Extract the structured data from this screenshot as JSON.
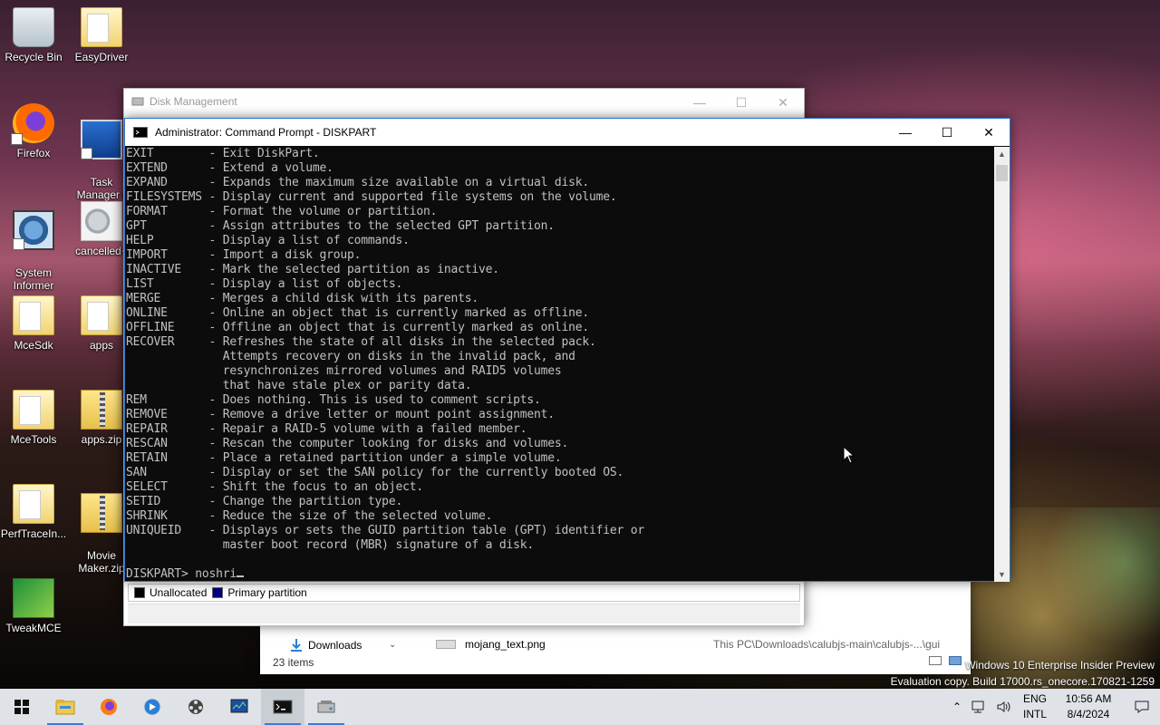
{
  "desktop": {
    "icons": [
      {
        "label": "Recycle Bin",
        "icon": "recycle-bin-icon"
      },
      {
        "label": "EasyDriver",
        "icon": "folder-icon"
      },
      {
        "label": "Firefox",
        "icon": "firefox-icon"
      },
      {
        "label": "Task\nManager (",
        "icon": "task-manager-icon"
      },
      {
        "label": "System\nInformer",
        "icon": "system-informer-icon"
      },
      {
        "label": "cancelled+",
        "icon": "gear-file-icon"
      },
      {
        "label": "MceSdk",
        "icon": "folder-icon"
      },
      {
        "label": "apps",
        "icon": "folder-icon"
      },
      {
        "label": "MceTools",
        "icon": "folder-icon"
      },
      {
        "label": "apps.zip",
        "icon": "zip-folder-icon"
      },
      {
        "label": "PerfTraceIn...",
        "icon": "folder-icon"
      },
      {
        "label": "Movie\nMaker.zip",
        "icon": "zip-folder-icon"
      },
      {
        "label": "TweakMCE",
        "icon": "tweakmce-icon"
      }
    ]
  },
  "disk_management": {
    "title": "Disk Management",
    "legend": [
      {
        "label": "Unallocated",
        "color": "#000000"
      },
      {
        "label": "Primary partition",
        "color": "#000080"
      }
    ]
  },
  "explorer": {
    "nav_item": "Downloads",
    "file_name": "mojang_text.png",
    "path": "This PC\\Downloads\\calubjs-main\\calubjs-...\\gui",
    "item_count": "23 items"
  },
  "cmd": {
    "title": "Administrator: Command Prompt - DISKPART",
    "lines": [
      "EXIT        - Exit DiskPart.",
      "EXTEND      - Extend a volume.",
      "EXPAND      - Expands the maximum size available on a virtual disk.",
      "FILESYSTEMS - Display current and supported file systems on the volume.",
      "FORMAT      - Format the volume or partition.",
      "GPT         - Assign attributes to the selected GPT partition.",
      "HELP        - Display a list of commands.",
      "IMPORT      - Import a disk group.",
      "INACTIVE    - Mark the selected partition as inactive.",
      "LIST        - Display a list of objects.",
      "MERGE       - Merges a child disk with its parents.",
      "ONLINE      - Online an object that is currently marked as offline.",
      "OFFLINE     - Offline an object that is currently marked as online.",
      "RECOVER     - Refreshes the state of all disks in the selected pack.",
      "              Attempts recovery on disks in the invalid pack, and",
      "              resynchronizes mirrored volumes and RAID5 volumes",
      "              that have stale plex or parity data.",
      "REM         - Does nothing. This is used to comment scripts.",
      "REMOVE      - Remove a drive letter or mount point assignment.",
      "REPAIR      - Repair a RAID-5 volume with a failed member.",
      "RESCAN      - Rescan the computer looking for disks and volumes.",
      "RETAIN      - Place a retained partition under a simple volume.",
      "SAN         - Display or set the SAN policy for the currently booted OS.",
      "SELECT      - Shift the focus to an object.",
      "SETID       - Change the partition type.",
      "SHRINK      - Reduce the size of the selected volume.",
      "UNIQUEID    - Displays or sets the GUID partition table (GPT) identifier or",
      "              master boot record (MBR) signature of a disk.",
      "",
      "DISKPART> noshri"
    ]
  },
  "watermark": {
    "line1": "Windows 10 Enterprise Insider Preview",
    "line2": "Evaluation copy. Build 17000.rs_onecore.170821-1259"
  },
  "taskbar": {
    "apps": [
      {
        "icon": "file-explorer-icon"
      },
      {
        "icon": "firefox-icon"
      },
      {
        "icon": "media-player-icon"
      },
      {
        "icon": "movie-maker-icon"
      },
      {
        "icon": "task-manager-icon"
      },
      {
        "icon": "command-prompt-icon",
        "active": true
      },
      {
        "icon": "disk-management-icon"
      }
    ],
    "language": "ENG",
    "layout": "INTL",
    "time": "10:56 AM",
    "date": "8/4/2024"
  }
}
